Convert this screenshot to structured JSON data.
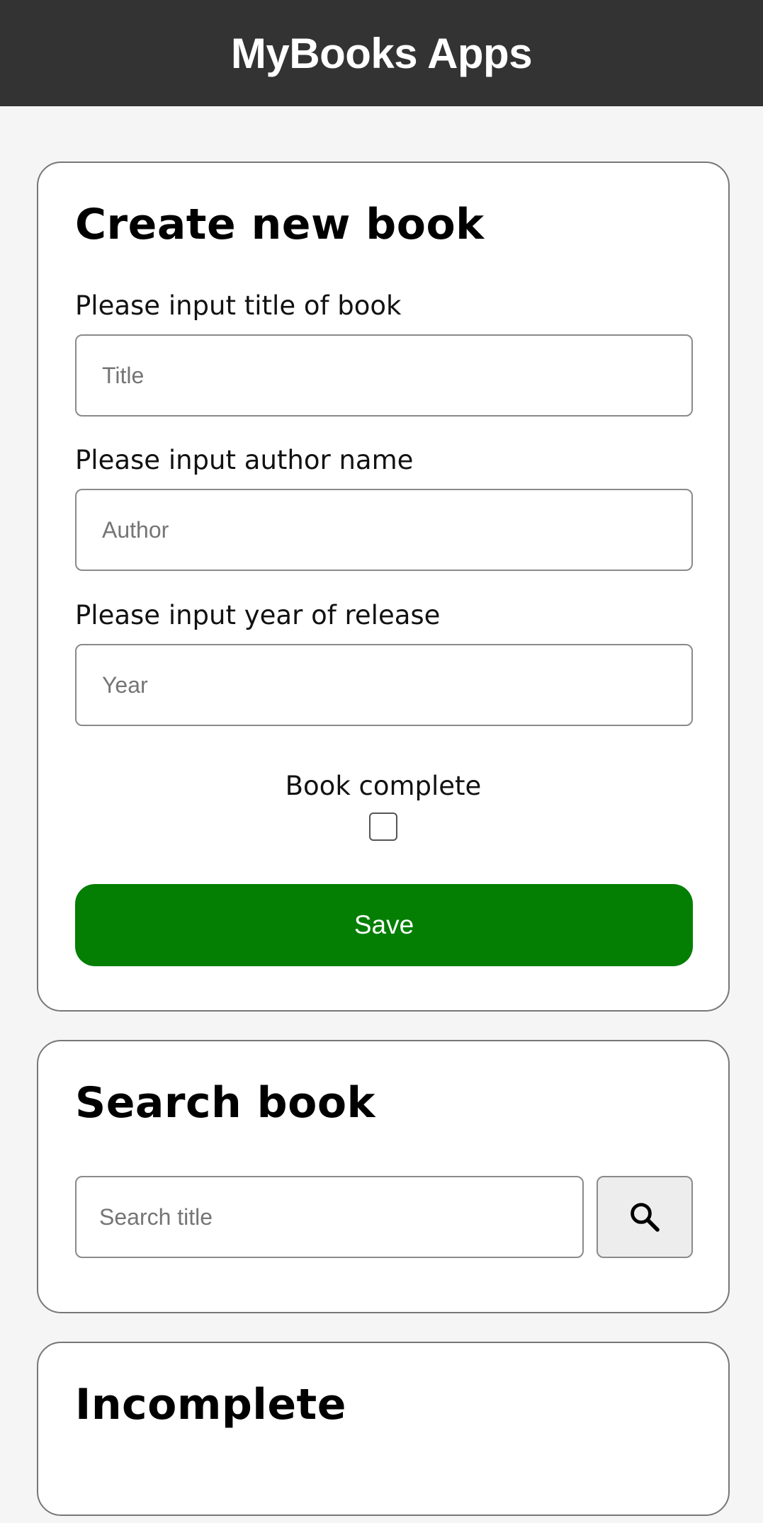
{
  "header": {
    "title": "MyBooks Apps"
  },
  "create": {
    "heading": "Create new book",
    "title_label": "Please input title of book",
    "title_placeholder": "Title",
    "author_label": "Please input author name",
    "author_placeholder": "Author",
    "year_label": "Please input year of release",
    "year_placeholder": "Year",
    "complete_label": "Book complete",
    "complete_checked": false,
    "save_label": "Save"
  },
  "search": {
    "heading": "Search book",
    "placeholder": "Search title",
    "button_icon": "search-icon"
  },
  "incomplete": {
    "heading": "Incomplete"
  },
  "colors": {
    "header_bg": "#333333",
    "save_bg": "#047f04",
    "page_bg": "#f5f5f5"
  }
}
